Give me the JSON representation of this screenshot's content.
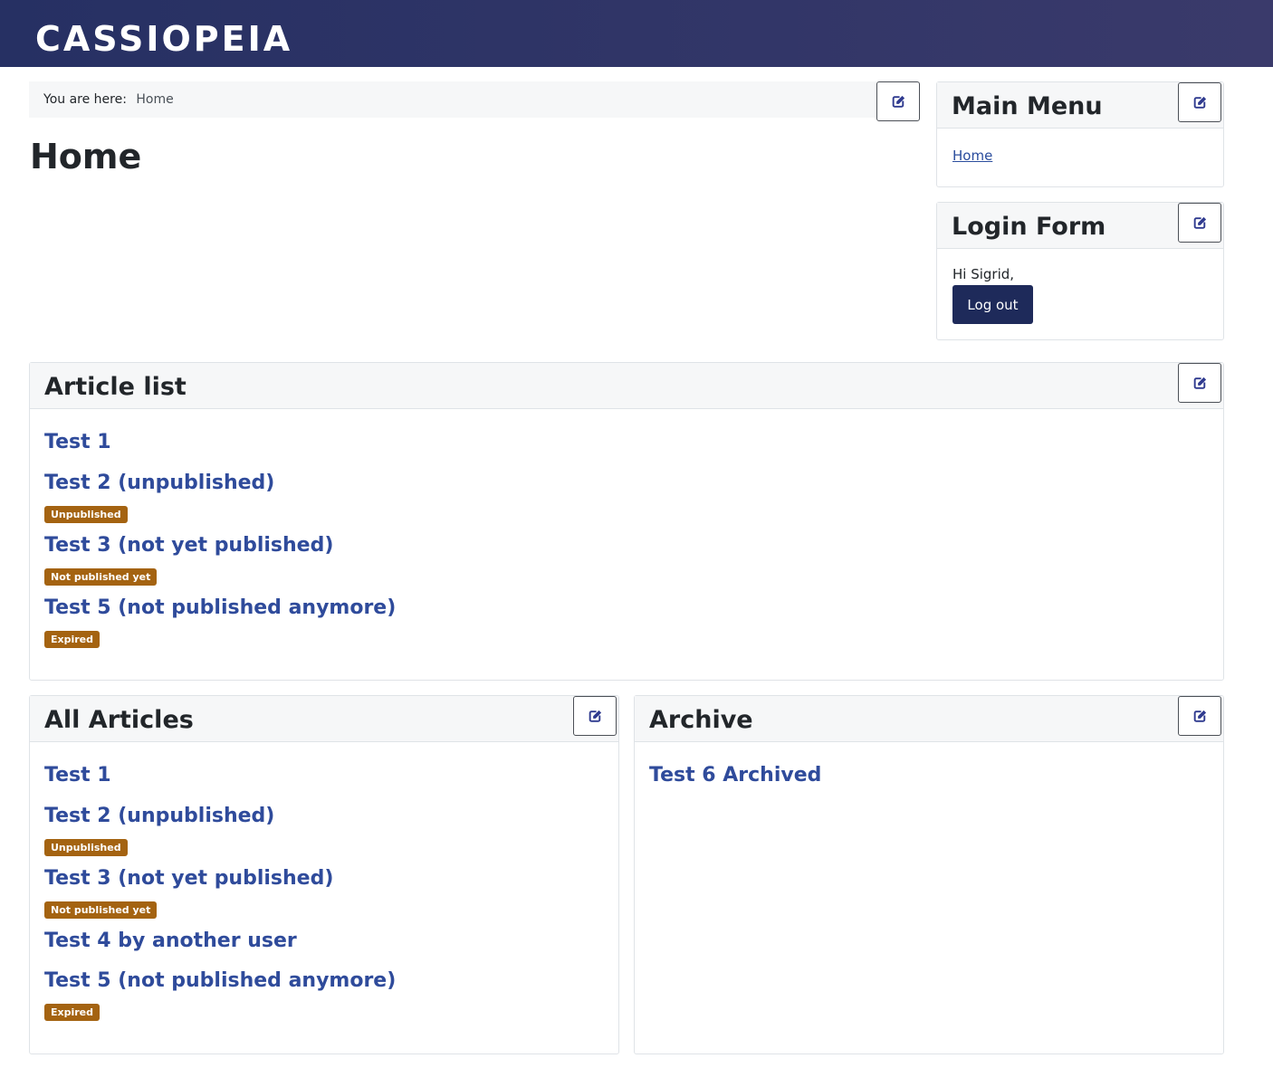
{
  "site": {
    "brand": "CASSIOPEIA"
  },
  "breadcrumb": {
    "prefix": "You are here:",
    "current": "Home"
  },
  "page": {
    "title": "Home"
  },
  "main_menu": {
    "title": "Main Menu",
    "items": [
      "Home"
    ]
  },
  "login_form": {
    "title": "Login Form",
    "greeting": "Hi Sigrid,",
    "logout_label": "Log out"
  },
  "article_list": {
    "title": "Article list",
    "items": [
      {
        "title": "Test 1",
        "badge": ""
      },
      {
        "title": "Test 2 (unpublished)",
        "badge": "Unpublished"
      },
      {
        "title": "Test 3 (not yet published)",
        "badge": "Not published yet"
      },
      {
        "title": "Test 5 (not published anymore)",
        "badge": "Expired"
      }
    ]
  },
  "all_articles": {
    "title": "All Articles",
    "items": [
      {
        "title": "Test 1",
        "badge": ""
      },
      {
        "title": "Test 2 (unpublished)",
        "badge": "Unpublished"
      },
      {
        "title": "Test 3 (not yet published)",
        "badge": "Not published yet"
      },
      {
        "title": "Test 4 by another user",
        "badge": ""
      },
      {
        "title": "Test 5 (not published anymore)",
        "badge": "Expired"
      }
    ]
  },
  "archive": {
    "title": "Archive",
    "items": [
      {
        "title": "Test 6 Archived"
      }
    ]
  },
  "icons": {
    "edit": "edit-icon"
  },
  "colors": {
    "header": "#263063",
    "link": "#2f4b9b",
    "badge": "#a46311",
    "button": "#1e2a5a"
  }
}
